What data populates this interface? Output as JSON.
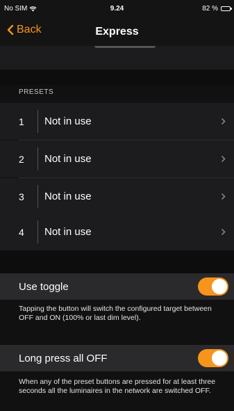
{
  "status_bar": {
    "carrier": "No SIM",
    "time": "9.24",
    "battery": "82 %"
  },
  "nav": {
    "back_label": "Back",
    "title": "Express"
  },
  "presets": {
    "header": "PRESETS",
    "items": [
      {
        "number": "1",
        "label": "Not in use"
      },
      {
        "number": "2",
        "label": "Not in use"
      },
      {
        "number": "3",
        "label": "Not in use"
      },
      {
        "number": "4",
        "label": "Not in use"
      }
    ]
  },
  "use_toggle": {
    "label": "Use toggle",
    "enabled": true,
    "description": "Tapping the button will switch the configured target between OFF and ON (100% or last dim level)."
  },
  "long_press": {
    "label": "Long press all OFF",
    "enabled": true,
    "description": "When any of the preset buttons are pressed for at least three seconds all the luminaires in the network are switched OFF."
  },
  "colors": {
    "accent": "#f7941d",
    "background": "#111111",
    "row": "#1c1c1e"
  },
  "icons": {
    "back": "chevron-left-icon",
    "row": "chevron-right-icon",
    "wifi": "wifi-icon",
    "battery": "battery-icon"
  }
}
